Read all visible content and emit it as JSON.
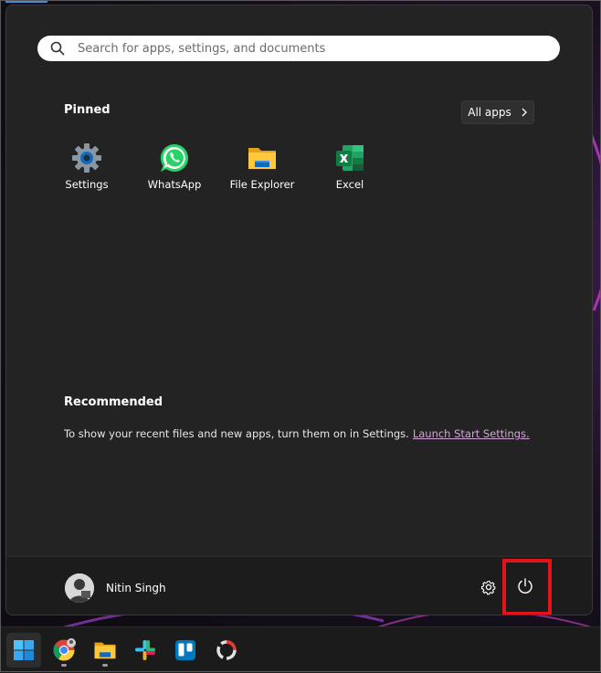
{
  "search": {
    "placeholder": "Search for apps, settings, and documents"
  },
  "pinned": {
    "title": "Pinned",
    "all_apps_label": "All apps",
    "apps": [
      {
        "label": "Settings",
        "icon": "settings-gear-icon"
      },
      {
        "label": "WhatsApp",
        "icon": "whatsapp-icon"
      },
      {
        "label": "File Explorer",
        "icon": "file-explorer-icon"
      },
      {
        "label": "Excel",
        "icon": "excel-icon"
      }
    ]
  },
  "recommended": {
    "title": "Recommended",
    "message": "To show your recent files and new apps, turn them on in Settings.",
    "link_label": "Launch Start Settings."
  },
  "user": {
    "name": "Nitin Singh"
  },
  "colors": {
    "menu_bg": "#232323",
    "footer_bg": "#1c1c1c",
    "highlight": "#e1141a",
    "link": "#d4a5d9",
    "accent": "#3d8fd6"
  },
  "taskbar": {
    "items": [
      {
        "icon": "windows-start-icon"
      },
      {
        "icon": "chrome-icon"
      },
      {
        "icon": "file-explorer-icon"
      },
      {
        "icon": "slack-icon"
      },
      {
        "icon": "trello-icon"
      },
      {
        "icon": "screen-recorder-icon"
      }
    ]
  }
}
